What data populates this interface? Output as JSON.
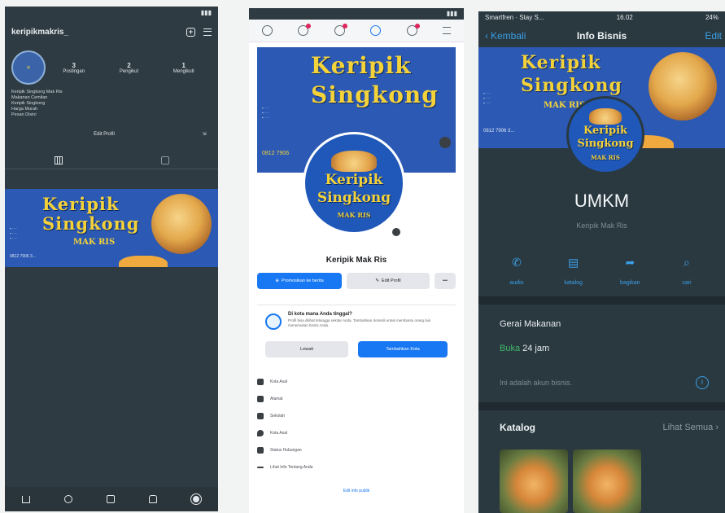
{
  "phone1": {
    "status": {
      "left": "",
      "right": "▮▮▮"
    },
    "username": "keripikmakris_",
    "stats": [
      {
        "num": "3",
        "label": "Postingan"
      },
      {
        "num": "2",
        "label": "Pengikut"
      },
      {
        "num": "1",
        "label": "Mengikuti"
      }
    ],
    "bio": [
      "Keripik Singkong Mak Ris",
      "Makanan Cemilan",
      "Keripik Singkong",
      "Harga Murah",
      "Pesan Disini"
    ],
    "edit_label": "Edit Profil",
    "banner": {
      "line1": "Keripik",
      "line2": "Singkong",
      "line3": "MAK RIS",
      "phone": "0812 7906 3..."
    }
  },
  "phone2": {
    "status": {
      "left": "",
      "right": "▮▮▮"
    },
    "cover": {
      "line1": "Keripik",
      "line2": "Singkong",
      "phone": "0812 7906"
    },
    "avatar": {
      "line1": "Keripik",
      "line2": "Singkong",
      "line3": "MAK RIS"
    },
    "page_name": "Keripik Mak Ris",
    "promote_label": "Promosikan ke berita",
    "edit_label": "Edit Profil",
    "more_label": "•••",
    "card": {
      "title": "Di kota mana Anda tinggal?",
      "desc": "Profil bisa dilihat tetangga sekitar Anda. Tambahkan domisili untuk membantu orang lain menemukan bisnis Anda.",
      "skip": "Lewati",
      "add": "Tambahkan Kota"
    },
    "list": [
      "Kota Asal",
      "Alamat",
      "Sekolah",
      "Kota Asal",
      "Status Hubungan"
    ],
    "see_info": "Lihat Info Tentang Anda",
    "edit_public": "Edit info publik"
  },
  "phone3": {
    "status": {
      "carrier": "Smartfren · Stay S...",
      "time": "16.02",
      "battery": "24%"
    },
    "back_label": "Kembali",
    "title": "Info Bisnis",
    "edit_label": "Edit",
    "banner": {
      "line1": "Keripik",
      "line2": "Singkong",
      "line3": "MAK RIS",
      "phone": "0812 7906 3..."
    },
    "avatar": {
      "line1": "Keripik",
      "line2": "Singkong",
      "line3": "MAK RIS"
    },
    "name": "UMKM",
    "subname": "Keripik Mak Ris",
    "actions": [
      {
        "label": "audio",
        "icon": "phone-icon"
      },
      {
        "label": "katalog",
        "icon": "catalog-icon"
      },
      {
        "label": "bagikan",
        "icon": "share-icon"
      },
      {
        "label": "cari",
        "icon": "search-icon"
      }
    ],
    "category": "Gerai Makanan",
    "open_status": "Buka",
    "open_hours": "24 jam",
    "business_note": "Ini adalah akun bisnis.",
    "catalog_title": "Katalog",
    "see_all": "Lihat Semua",
    "colors": {
      "accent": "#3aa0e6",
      "open": "#3fb86a"
    }
  }
}
